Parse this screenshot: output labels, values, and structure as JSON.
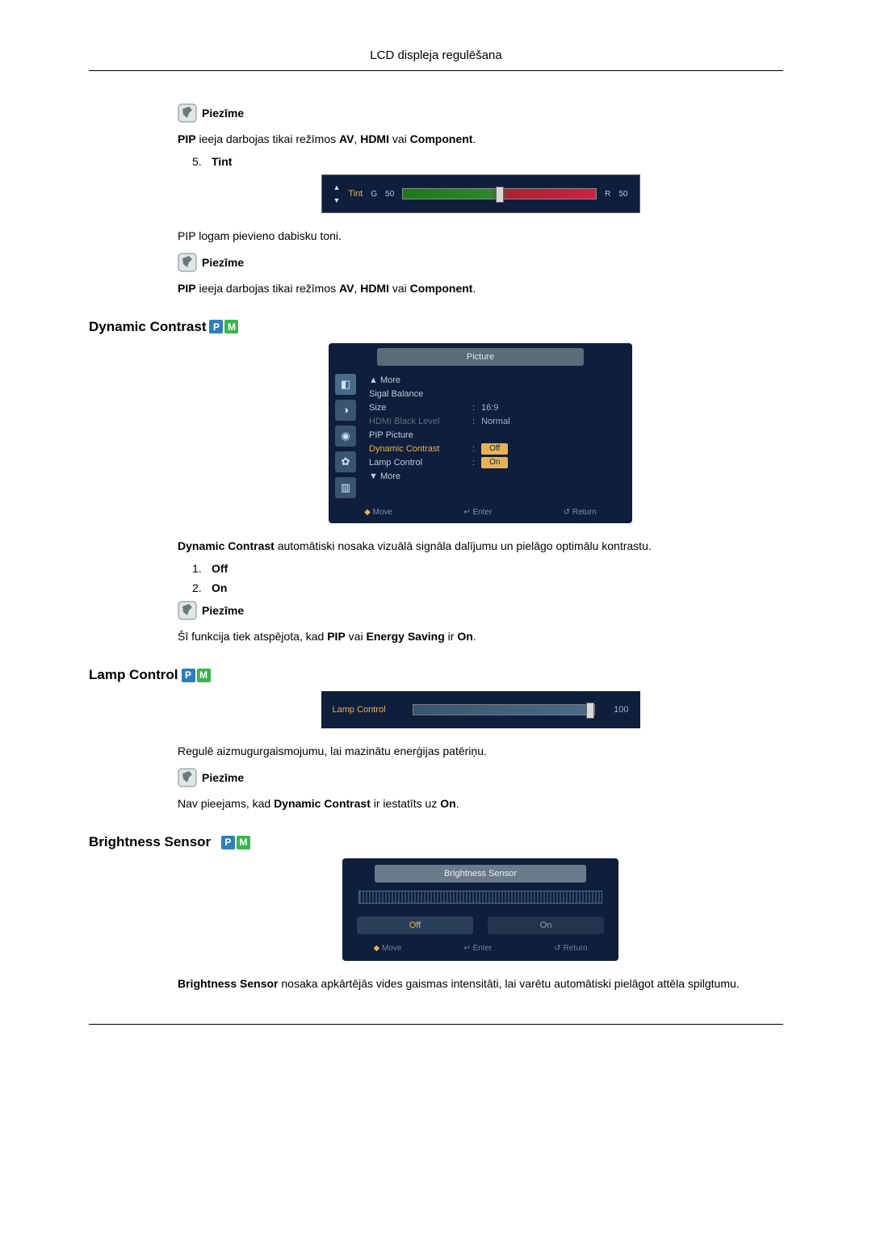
{
  "header": "LCD displeja regulēšana",
  "note_label": "Piezīme",
  "pip_note_parts": {
    "p1": "PIP",
    "p2": " ieeja darbojas tikai režīmos ",
    "p3": "AV",
    "p4": ", ",
    "p5": "HDMI",
    "p6": " vai ",
    "p7": "Component",
    "p8": "."
  },
  "tint": {
    "num": "5.",
    "label": "Tint",
    "g_label": "G",
    "g_val": "50",
    "r_label": "R",
    "r_val": "50",
    "arrow_up": "▲",
    "arrow_down": "▼",
    "name": "Tint",
    "desc": "PIP logam pievieno dabisku toni."
  },
  "dyn": {
    "heading": "Dynamic Contrast",
    "badge_p": "P",
    "badge_m": "M",
    "desc_parts": {
      "p1": "Dynamic Contrast",
      "p2": " automātiski nosaka vizuālā signāla dalījumu un pielāgo optimālu kontrastu."
    },
    "opt1_num": "1.",
    "opt1": "Off",
    "opt2_num": "2.",
    "opt2": "On",
    "note_parts": {
      "p1": "Šī funkcija tiek atspējota, kad ",
      "p2": "PIP",
      "p3": " vai ",
      "p4": "Energy Saving",
      "p5": " ir ",
      "p6": "On",
      "p7": "."
    },
    "osd": {
      "title": "Picture",
      "more_up": "▲ More",
      "items": [
        {
          "k": "Sigal Balance",
          "v": "",
          "dim": false
        },
        {
          "k": "Size",
          "v": "16:9",
          "dim": false
        },
        {
          "k": "HDMI Black Level",
          "v": "Normal",
          "dim": true
        },
        {
          "k": "PIP Picture",
          "v": "",
          "dim": false
        }
      ],
      "sel_item": {
        "k": "Dynamic Contrast",
        "v": "Off"
      },
      "after_sel": {
        "k": "Lamp Control",
        "v": "On"
      },
      "more_down": "▼ More",
      "foot_move": "Move",
      "foot_enter": "Enter",
      "foot_return": "Return",
      "enter_glyph": "↵",
      "return_glyph": "↺",
      "move_glyph": "◆",
      "sep": ":"
    }
  },
  "lamp": {
    "heading": "Lamp Control",
    "badge_p": "P",
    "badge_m": "M",
    "osd_label": "Lamp Control",
    "osd_value": "100",
    "desc": "Regulē aizmugurgaismojumu, lai mazinātu enerģijas patēriņu.",
    "note_parts": {
      "p1": "Nav pieejams, kad ",
      "p2": "Dynamic Contrast",
      "p3": " ir iestatīts uz ",
      "p4": "On",
      "p5": "."
    }
  },
  "bs": {
    "heading": "Brightness Sensor",
    "badge_p": "P",
    "badge_m": "M",
    "osd_title": "Brightness Sensor",
    "opt_off": "Off",
    "opt_on": "On",
    "foot_move": "Move",
    "foot_enter": "Enter",
    "foot_return": "Return",
    "move_glyph": "◆",
    "enter_glyph": "↵",
    "return_glyph": "↺",
    "desc_parts": {
      "p1": "Brightness Sensor",
      "p2": " nosaka apkārtējās vides gaismas intensitāti, lai varētu automātiski pielāgot attēla spilgtumu."
    }
  }
}
